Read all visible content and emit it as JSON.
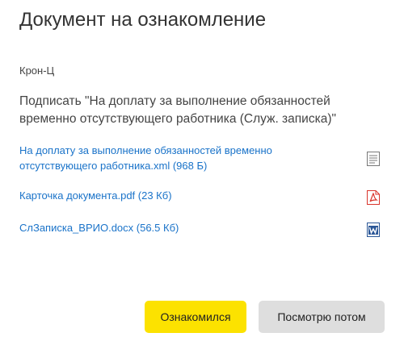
{
  "dialog": {
    "title": "Документ на ознакомление",
    "organization": "Крон-Ц",
    "task": "Подписать \"На доплату за выполнение обязанностей временно отсутствующего работника (Служ. записка)\""
  },
  "attachments": [
    {
      "label": "На доплату за выполнение обязанностей временно отсутствующего работника.xml  (968 Б)",
      "icon": "text-document-icon"
    },
    {
      "label": "Карточка документа.pdf  (23 Кб)",
      "icon": "pdf-file-icon"
    },
    {
      "label": "СлЗаписка_ВРИО.docx  (56.5 Кб)",
      "icon": "word-file-icon"
    }
  ],
  "buttons": {
    "acknowledge": "Ознакомился",
    "later": "Посмотрю потом"
  },
  "colors": {
    "link": "#1a73c9",
    "primary_button": "#fce200",
    "secondary_button": "#dedede",
    "pdf_icon": "#d9342b",
    "word_icon": "#2b5797"
  }
}
